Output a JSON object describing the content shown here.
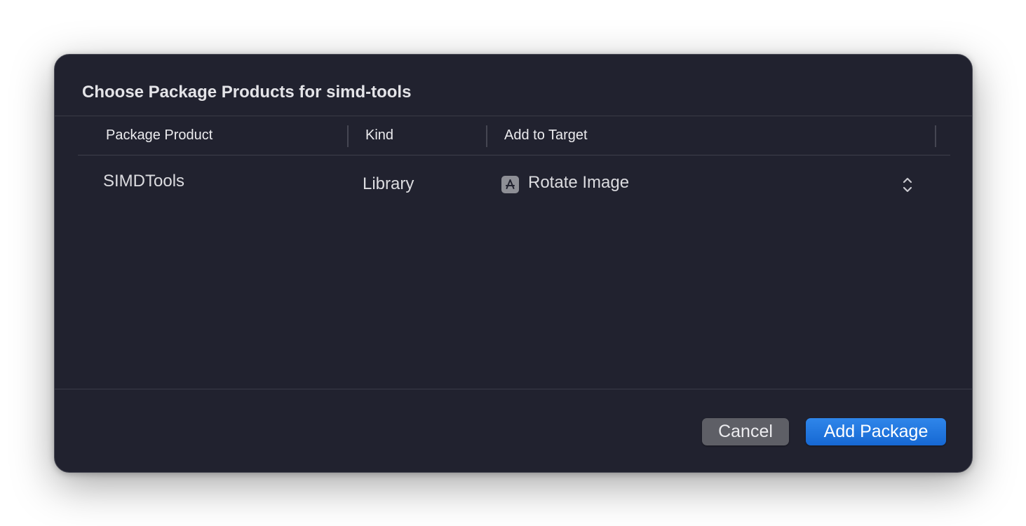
{
  "dialog": {
    "title": "Choose Package Products for simd-tools"
  },
  "table": {
    "columns": [
      "Package Product",
      "Kind",
      "Add to Target"
    ],
    "rows": [
      {
        "product": "SIMDTools",
        "kind": "Library",
        "target": "Rotate Image",
        "target_icon": "app-store-icon"
      }
    ]
  },
  "buttons": {
    "cancel": "Cancel",
    "add": "Add Package"
  },
  "colors": {
    "background": "#21222f",
    "accent": "#1f74e0",
    "cancel_button": "#5e5f66"
  }
}
